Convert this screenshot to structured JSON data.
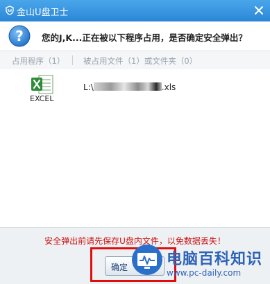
{
  "window": {
    "title": "金山U盘卫士"
  },
  "header": {
    "question": "您的J,K...正在被以下程序占用，是否确定安全弹出？"
  },
  "tabs": [
    {
      "label": "占用程序（1）"
    },
    {
      "label": "被占用文件（1）或文件夹（0）"
    }
  ],
  "program": {
    "icon": "excel-icon",
    "name": "EXCEL",
    "file_prefix": "L:\\",
    "file_suffix": ".xls"
  },
  "footer": {
    "warning": "安全弹出前请先保存U盘内文件，以免数据丢失！",
    "confirm_label": "确定"
  },
  "watermark": {
    "title": "电脑百科知识",
    "url": "www.pc-daily.com"
  },
  "colors": {
    "titlebar": "#2a86d6",
    "warning": "#cc1111",
    "highlight": "#e10c0c",
    "watermark": "#2d63b8"
  }
}
